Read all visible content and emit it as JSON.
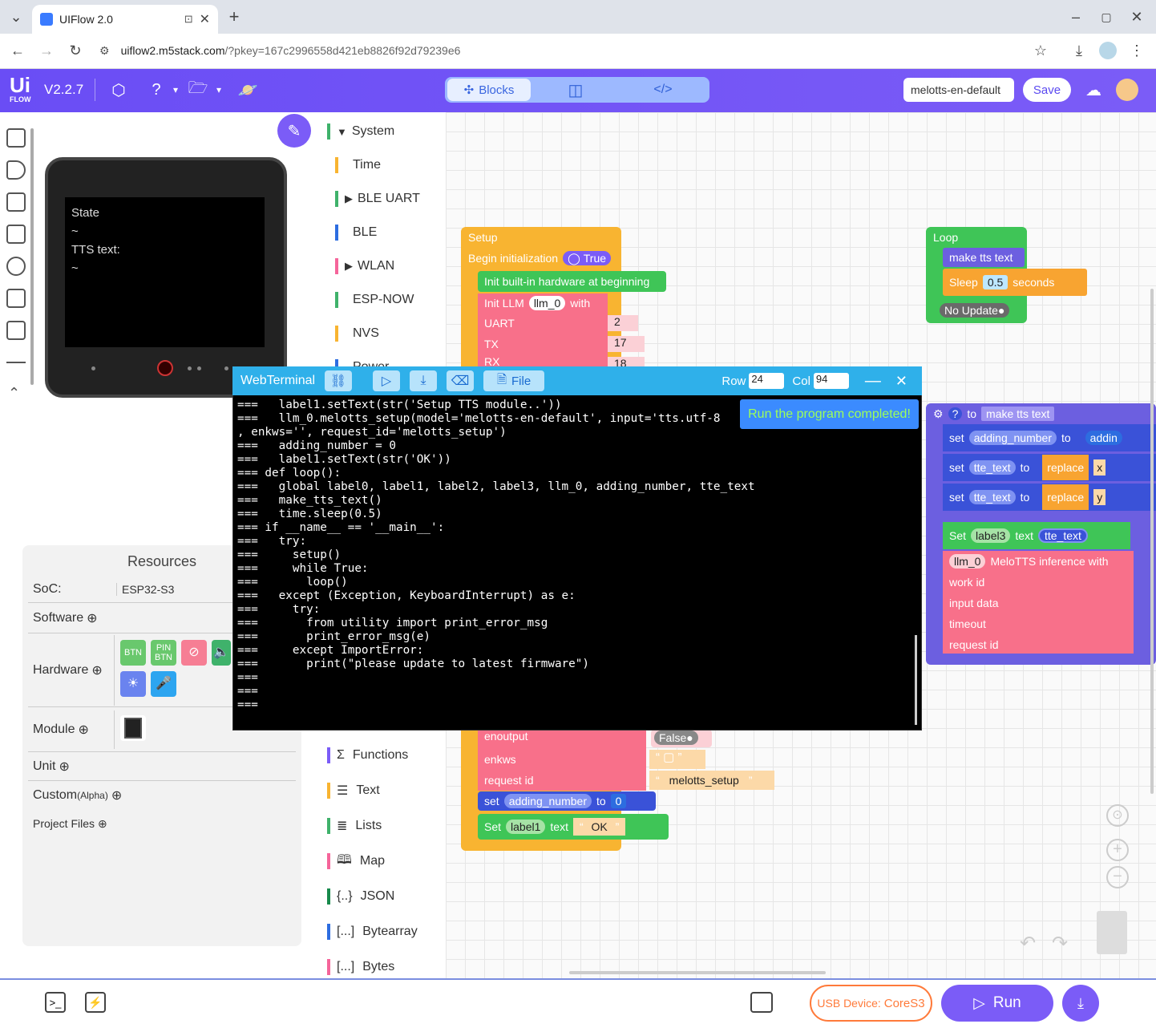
{
  "browser": {
    "tab_title": "UIFlow 2.0",
    "url_host": "uiflow2.m5stack.com",
    "url_rest": "/?pkey=167c2996558d421eb8826f92d79239e6"
  },
  "header": {
    "version": "V2.2.7",
    "modes": {
      "blocks": "Blocks"
    },
    "project_name": "melotts-en-default",
    "save_label": "Save"
  },
  "device_screen": {
    "line1": "State",
    "line2": "~",
    "line3": "TTS text:",
    "line4": "~"
  },
  "resources": {
    "title": "Resources",
    "soc_label": "SoC:",
    "soc_value": "ESP32-S3",
    "software": "Software",
    "hardware": "Hardware",
    "module": "Module",
    "unit": "Unit",
    "custom": "Custom",
    "custom_tag": "(Alpha)",
    "project_files": "Project Files",
    "chips": {
      "btn": "BTN",
      "pin_btn_1": "PIN",
      "pin_btn_2": "BTN"
    }
  },
  "categories": {
    "system": "System",
    "time": "Time",
    "ble_uart": "BLE UART",
    "ble": "BLE",
    "wlan": "WLAN",
    "espnow": "ESP-NOW",
    "nvs": "NVS",
    "power": "Power",
    "functions": "Functions",
    "text": "Text",
    "lists": "Lists",
    "map": "Map",
    "json": "JSON",
    "bytearray": "Bytearray",
    "bytes": "Bytes"
  },
  "blocks": {
    "setup": "Setup",
    "begin_init": "Begin initialization",
    "true_label": "True",
    "init_hw": "Init built-in hardware at beginning",
    "init_llm": "Init LLM",
    "llm0": "llm_0",
    "with": "with",
    "uart": "UART",
    "uart_val": "2",
    "tx": "TX",
    "tx_val": "17",
    "rx": "RX",
    "rx_val": "18",
    "enoutput": "enoutput",
    "false_label": "False",
    "enkws": "enkws",
    "request_id": "request id",
    "melotts_setup": "melotts_setup",
    "set": "set",
    "adding_number": "adding_number",
    "to": "to",
    "zero": "0",
    "set_cap": "Set",
    "label1": "label1",
    "text": "text",
    "ok": "OK",
    "loop": "Loop",
    "make_tts_text": "make tts text",
    "sleep": "Sleep",
    "sleep_val": "0.5",
    "seconds": "seconds",
    "no_update": "No Update",
    "to_make": "to",
    "fn_name": "make tts text",
    "addin": "addin",
    "tte_text": "tte_text",
    "replace": "replace",
    "x": "x",
    "y": "y",
    "label3": "label3",
    "melotts_inf": "MeloTTS inference with",
    "work_id": "work id",
    "input_data": "input data",
    "timeout": "timeout",
    "request_id2": "request id"
  },
  "terminal": {
    "title": "WebTerminal",
    "file_label": "File",
    "row_label": "Row",
    "row_val": "24",
    "col_label": "Col",
    "col_val": "94",
    "toast": "Run the program completed!",
    "content": "===   label1.setText(str('Setup TTS module..'))\n===   llm_0.melotts_setup(model='melotts-en-default', input='tts.utf-8\n, enkws='', request_id='melotts_setup')\n===   adding_number = 0\n===   label1.setText(str('OK'))\n=== def loop():\n===   global label0, label1, label2, label3, llm_0, adding_number, tte_text\n===   make_tts_text()\n===   time.sleep(0.5)\n=== if __name__ == '__main__':\n===   try:\n===     setup()\n===     while True:\n===       loop()\n===   except (Exception, KeyboardInterrupt) as e:\n===     try:\n===       from utility import print_error_msg\n===       print_error_msg(e)\n===     except ImportError:\n===       print(\"please update to latest firmware\")\n===\n===\n==="
  },
  "footer": {
    "usb_label": "USB Device:",
    "usb_device": "CoreS3",
    "run_label": "Run"
  },
  "colors": {
    "brand": "#7b5cf7",
    "terminal_header": "#2fb0ea",
    "toast_text": "#9cff58"
  }
}
